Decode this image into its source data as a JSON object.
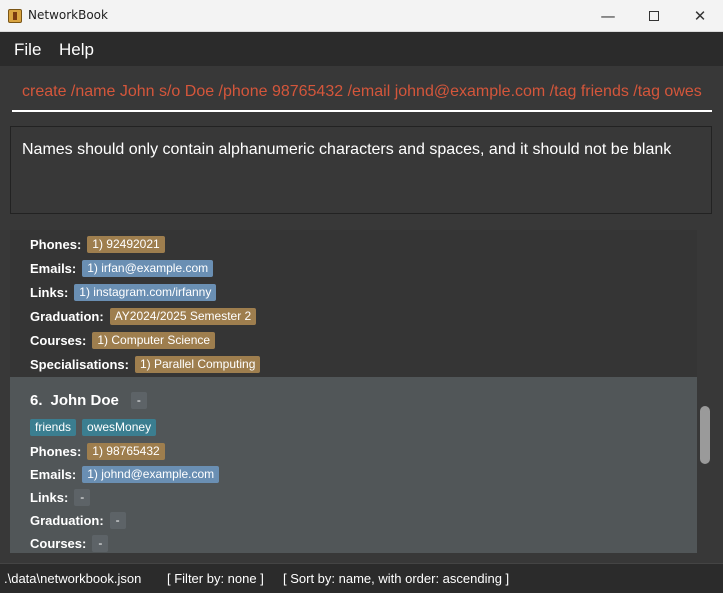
{
  "window": {
    "title": "NetworkBook",
    "minimize_glyph": "—",
    "close_glyph": "✕"
  },
  "menu": {
    "file": "File",
    "help": "Help"
  },
  "command": {
    "value": "create /name John s/o Doe /phone 98765432 /email johnd@example.com /tag friends /tag owesMoney"
  },
  "result": {
    "text": "Names should only contain alphanumeric characters and spaces, and it should not be blank"
  },
  "labels": {
    "phones": "Phones:",
    "emails": "Emails:",
    "links": "Links:",
    "graduation": "Graduation:",
    "courses": "Courses:",
    "specialisations": "Specialisations:"
  },
  "contacts": [
    {
      "phones": [
        "1) 92492021"
      ],
      "emails": [
        "1) irfan@example.com"
      ],
      "links": [
        "1) instagram.com/irfanny"
      ],
      "graduation": "AY2024/2025 Semester 2",
      "courses": [
        "1) Computer Science"
      ],
      "specialisations": [
        "1) Parallel Computing"
      ]
    },
    {
      "index": "6.",
      "name": "John Doe",
      "priority": "-",
      "tags": [
        "friends",
        "owesMoney"
      ],
      "phones": [
        "1) 98765432"
      ],
      "emails": [
        "1) johnd@example.com"
      ],
      "links": "-",
      "graduation": "-",
      "courses": "-"
    }
  ],
  "status": {
    "path": ".\\data\\networkbook.json",
    "filter": "[ Filter by: none ]",
    "sort": "[ Sort by: name, with order: ascending ]"
  },
  "colors": {
    "badge_gold": "#9e7e4e",
    "badge_blue": "#6a8fb3",
    "badge_teal": "#3b7e90",
    "command_text": "#d4563b",
    "selected_card": "#515658"
  }
}
